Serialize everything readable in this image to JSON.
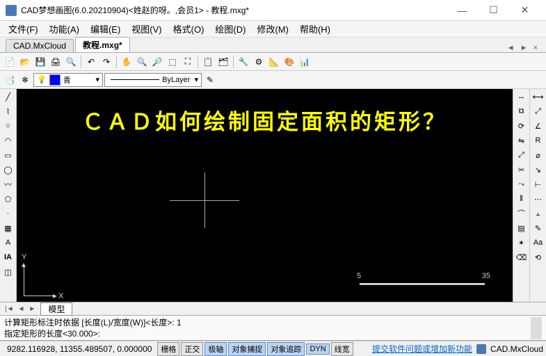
{
  "window": {
    "title": "CAD梦想画图(6.0.20210904)<姓赵的呀。,会员1> - 教程.mxg*"
  },
  "menu": {
    "items": [
      "文件(F)",
      "功能(A)",
      "编辑(E)",
      "视图(V)",
      "格式(O)",
      "绘图(D)",
      "修改(M)",
      "帮助(H)"
    ]
  },
  "tabs": {
    "t0": "CAD.MxCloud",
    "t1": "教程.mxg*"
  },
  "props": {
    "layer_name": "青",
    "linetype": "ByLayer"
  },
  "canvas": {
    "headline": "ＣＡＤ如何绘制固定面积的矩形？",
    "ucs_x": "X",
    "ucs_y": "Y",
    "ruler_a": "5",
    "ruler_b": "35"
  },
  "model_tab": "模型",
  "cmd": {
    "line1": "计算矩形标注时依据 [长度(L)/宽度(W)]<长度>: 1",
    "line2": "指定矩形的长度<30.000>:"
  },
  "status": {
    "coords": "9282.116928, 11355.489507, 0.000000",
    "b_grid": "栅格",
    "b_ortho": "正交",
    "b_polar": "极轴",
    "b_osnap": "对象捕捉",
    "b_otrack": "对象追踪",
    "b_dyn": "DYN",
    "b_lwt": "线宽",
    "link": "提交软件问题或增加新功能",
    "brand": "CAD.MxCloud"
  }
}
